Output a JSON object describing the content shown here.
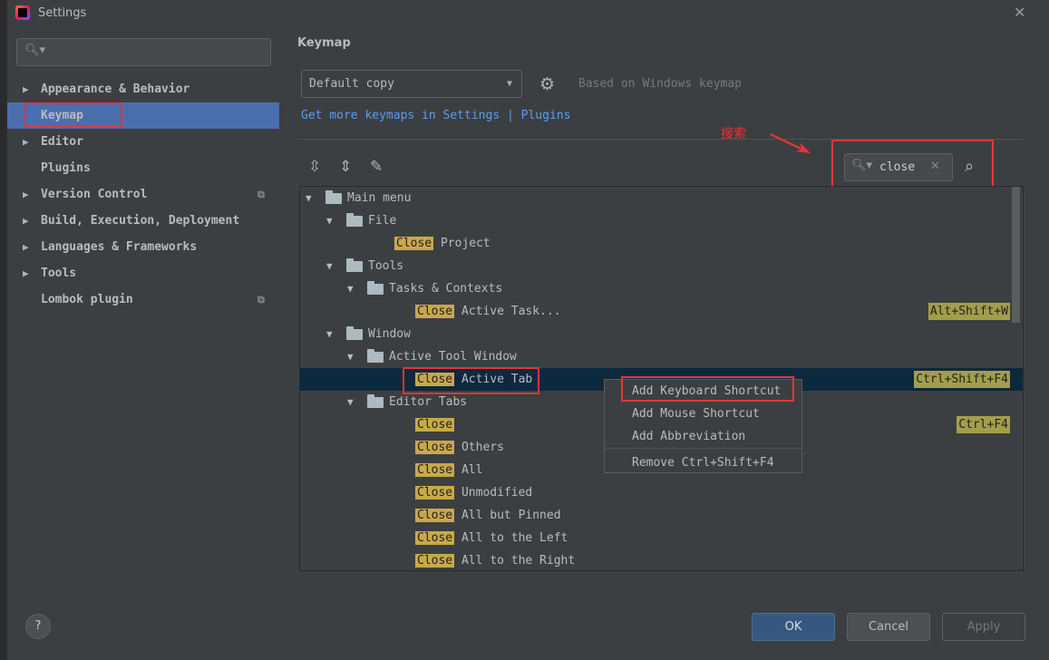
{
  "window": {
    "title": "Settings"
  },
  "sidebar": {
    "search_placeholder": "",
    "items": [
      {
        "label": "Appearance & Behavior",
        "expandable": true
      },
      {
        "label": "Keymap",
        "expandable": false,
        "selected": true
      },
      {
        "label": "Editor",
        "expandable": true
      },
      {
        "label": "Plugins",
        "expandable": false
      },
      {
        "label": "Version Control",
        "expandable": true,
        "project_icon": true
      },
      {
        "label": "Build, Execution, Deployment",
        "expandable": true
      },
      {
        "label": "Languages & Frameworks",
        "expandable": true
      },
      {
        "label": "Tools",
        "expandable": true
      },
      {
        "label": "Lombok plugin",
        "expandable": false,
        "project_icon": true
      }
    ]
  },
  "main": {
    "heading": "Keymap",
    "keymap_select": "Default copy",
    "based_on": "Based on Windows keymap",
    "link_text": "Get more keymaps in Settings",
    "link_sep": "|",
    "link_plugins": "Plugins",
    "annotation": "搜索",
    "filter_value": "close"
  },
  "tree": [
    {
      "level": 0,
      "expanded": true,
      "folder": true,
      "rest": "Main menu"
    },
    {
      "level": 1,
      "expanded": true,
      "folder": true,
      "rest": "File"
    },
    {
      "level": 2,
      "hl": "Close",
      "rest": " Project"
    },
    {
      "level": 1,
      "expanded": true,
      "folder": true,
      "rest": "Tools"
    },
    {
      "level": 2,
      "expanded": true,
      "folder": true,
      "rest": "Tasks & Contexts"
    },
    {
      "level": 3,
      "hl": "Close",
      "rest": " Active Task...",
      "shortcut": "Alt+Shift+W"
    },
    {
      "level": 1,
      "expanded": true,
      "folder": true,
      "rest": "Window"
    },
    {
      "level": 2,
      "expanded": true,
      "folder": true,
      "rest": "Active Tool Window"
    },
    {
      "level": 3,
      "hl": "Close",
      "rest": " Active Tab",
      "shortcut": "Ctrl+Shift+F4",
      "selected": true
    },
    {
      "level": 2,
      "expanded": true,
      "folder": true,
      "rest": "Editor Tabs"
    },
    {
      "level": 3,
      "hl": "Close",
      "rest": "",
      "shortcut": "Ctrl+F4"
    },
    {
      "level": 3,
      "hl": "Close",
      "rest": " Others"
    },
    {
      "level": 3,
      "hl": "Close",
      "rest": " All"
    },
    {
      "level": 3,
      "hl": "Close",
      "rest": " Unmodified"
    },
    {
      "level": 3,
      "hl": "Close",
      "rest": " All but Pinned"
    },
    {
      "level": 3,
      "hl": "Close",
      "rest": " All to the Left"
    },
    {
      "level": 3,
      "hl": "Close",
      "rest": " All to the Right"
    }
  ],
  "context_menu": [
    "Add Keyboard Shortcut",
    "Add Mouse Shortcut",
    "Add Abbreviation",
    "Remove Ctrl+Shift+F4"
  ],
  "footer": {
    "help": "?",
    "ok": "OK",
    "cancel": "Cancel",
    "apply": "Apply"
  },
  "colors": {
    "selection": "#4b6eaf",
    "tree_selection": "#0d293e",
    "highlight": "#c8a84b",
    "annotation": "#e8343a",
    "link": "#589df6"
  }
}
